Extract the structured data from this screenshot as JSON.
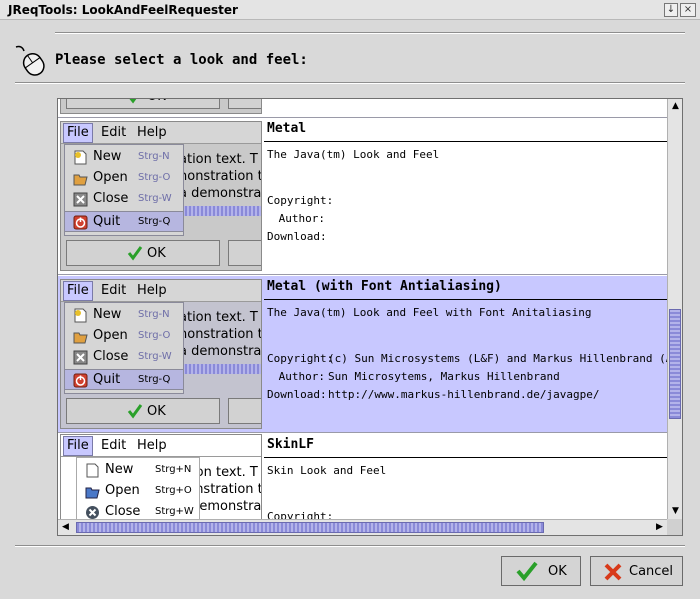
{
  "window": {
    "title": "JReqTools: LookAndFeelRequester",
    "btn_iconify": "↓",
    "btn_maximize": "□",
    "btn_close": "×"
  },
  "header": {
    "prompt": "Please select a look and feel:",
    "icon": "mouse-icon"
  },
  "preview": {
    "menus": [
      "File",
      "Edit",
      "Help"
    ],
    "text_lines": [
      "ation text. T",
      "nonstration t",
      "a demonstra"
    ],
    "items": [
      {
        "label": "New",
        "accel": "Strg-N"
      },
      {
        "label": "Open",
        "accel": "Strg-O"
      },
      {
        "label": "Close",
        "accel": "Strg-W"
      },
      {
        "label": "Quit",
        "accel": "Strg-Q"
      }
    ],
    "items_skin": [
      {
        "label": "New",
        "accel": "Strg+N"
      },
      {
        "label": "Open",
        "accel": "Strg+O"
      },
      {
        "label": "Close",
        "accel": "Strg+W"
      }
    ],
    "ok_label": "OK",
    "ok_partial": "OK"
  },
  "lafs": [
    {
      "name": "Metal",
      "description": "The Java(tm) Look and Feel",
      "copyright": "",
      "author": "",
      "download": ""
    },
    {
      "name": "Metal (with Font Antialiasing)",
      "description": "The Java(tm) Look and Feel with Font Anitaliasing",
      "copyright": "(c) Sun Microsystems (L&F) and Markus Hillenbrand (Antialias",
      "author": "Sun Microsytems, Markus Hillenbrand",
      "download": "http://www.markus-hillenbrand.de/javagpe/"
    },
    {
      "name": "SkinLF",
      "description": "Skin Look and Feel",
      "copyright": "",
      "author": "",
      "download": ""
    }
  ],
  "labels": {
    "copyright": "Copyright:",
    "author": "Author:",
    "download": "Download:"
  },
  "buttons": {
    "ok": "OK",
    "cancel": "Cancel"
  },
  "colors": {
    "selection": "#c8c8ff",
    "scroll_thumb": "#8a8ad8",
    "ok_check": "#2aa02a",
    "cancel_x": "#d83a1a"
  }
}
